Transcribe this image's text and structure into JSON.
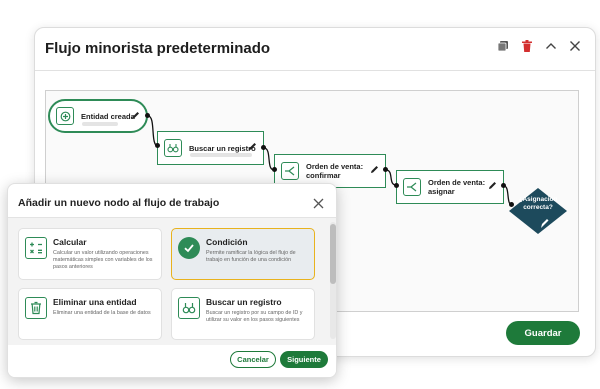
{
  "window": {
    "title": "Flujo minorista predeterminado",
    "save_label": "Guardar"
  },
  "workflow": {
    "nodes": [
      {
        "label": "Entidad creada",
        "icon": "entity-icon"
      },
      {
        "label": "Buscar un registro",
        "icon": "binoculars-icon"
      },
      {
        "label": "Orden de venta: confirmar",
        "icon": "branch-icon"
      },
      {
        "label": "Orden de venta: asignar",
        "icon": "branch-icon"
      }
    ],
    "decision": {
      "label": "¿Asignación correcta?",
      "color": "#1d4a5c"
    }
  },
  "dialog": {
    "title": "Añadir un nuevo nodo al flujo de trabajo",
    "options": [
      {
        "title": "Calcular",
        "description": "Calcular un valor utilizando operaciones matemáticas simples con variables de los pasos anteriores",
        "icon": "calculator-icon",
        "selected": false
      },
      {
        "title": "Condición",
        "description": "Permite ramificar la lógica del flujo de trabajo en función de una condición",
        "icon": "check-circle-icon",
        "selected": true
      },
      {
        "title": "Eliminar una entidad",
        "description": "Eliminar una entidad de la base de datos",
        "icon": "trash-icon",
        "selected": false
      },
      {
        "title": "Buscar un registro",
        "description": "Buscar un registro por su campo de ID y utilizar su valor en los pasos siguientes",
        "icon": "binoculars-icon",
        "selected": false
      }
    ],
    "cancel_label": "Cancelar",
    "next_label": "Siguiente"
  },
  "colors": {
    "accent": "#1e7a3a",
    "node_border": "#2e8b57",
    "selected_border": "#e8b21d",
    "delete": "#d32f2f"
  }
}
